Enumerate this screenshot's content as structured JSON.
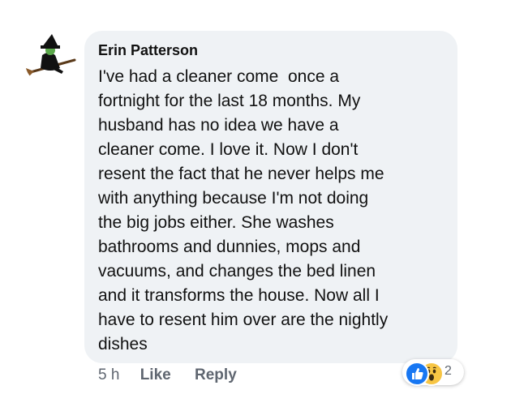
{
  "comment": {
    "author": "Erin Patterson",
    "text_lines": [
      "I've had a cleaner come  once a",
      "fortnight for the last 18 months. My",
      "husband has no idea we have a",
      "cleaner come. I love it. Now I don't",
      "resent the fact that he never helps me",
      "with anything because I'm not doing",
      "the big jobs either. She washes",
      "bathrooms and dunnies, mops and",
      "vacuums, and changes the bed linen",
      "and it transforms the house. Now all I",
      "have to resent him over are the nightly",
      "dishes"
    ],
    "timestamp": "5 h",
    "like_label": "Like",
    "reply_label": "Reply",
    "reactions": {
      "types": [
        "like-icon",
        "wow-icon"
      ],
      "count": "2"
    }
  },
  "colors": {
    "bubble": "#eff2f5",
    "text": "#111111",
    "meta": "#5f6670",
    "like_reaction": "#1877f2",
    "wow_reaction": "#f7c544"
  }
}
